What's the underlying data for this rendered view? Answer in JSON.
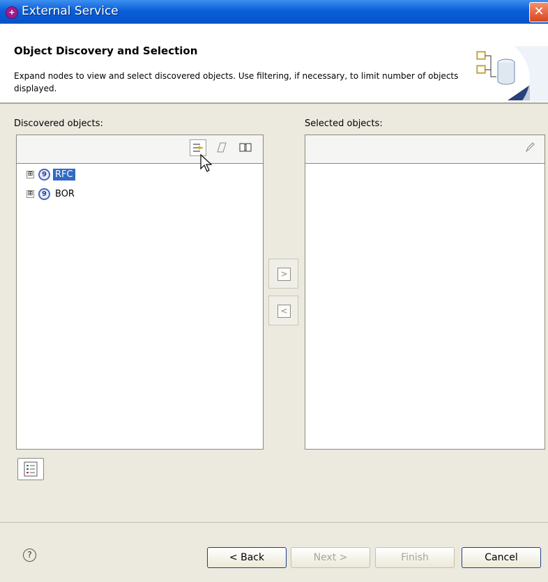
{
  "window": {
    "title": "External Service",
    "icon": "app-icon",
    "close_label": "✕"
  },
  "header": {
    "title": "Object Discovery and Selection",
    "description": "Expand nodes to view and select discovered objects.  Use filtering, if necessary, to limit number of objects displayed."
  },
  "discovered": {
    "label": "Discovered objects:",
    "toolbar": [
      "filter-icon",
      "edit-query-icon",
      "book-icon"
    ],
    "items": [
      {
        "label": "RFC",
        "selected": true,
        "expander": "⊞",
        "icon": "rfc-icon"
      },
      {
        "label": "BOR",
        "selected": false,
        "expander": "⊞",
        "icon": "bor-icon"
      }
    ]
  },
  "selected": {
    "label": "Selected objects:",
    "toolbar": [
      "edit-icon"
    ]
  },
  "move": {
    "add_label": ">",
    "remove_label": "<"
  },
  "footer": {
    "help_label": "?",
    "back_label": "< Back",
    "next_label": "Next >",
    "finish_label": "Finish",
    "cancel_label": "Cancel"
  },
  "colors": {
    "titlebar": "#0a5fd8",
    "selection": "#316ac5",
    "content_bg": "#eceadf"
  }
}
